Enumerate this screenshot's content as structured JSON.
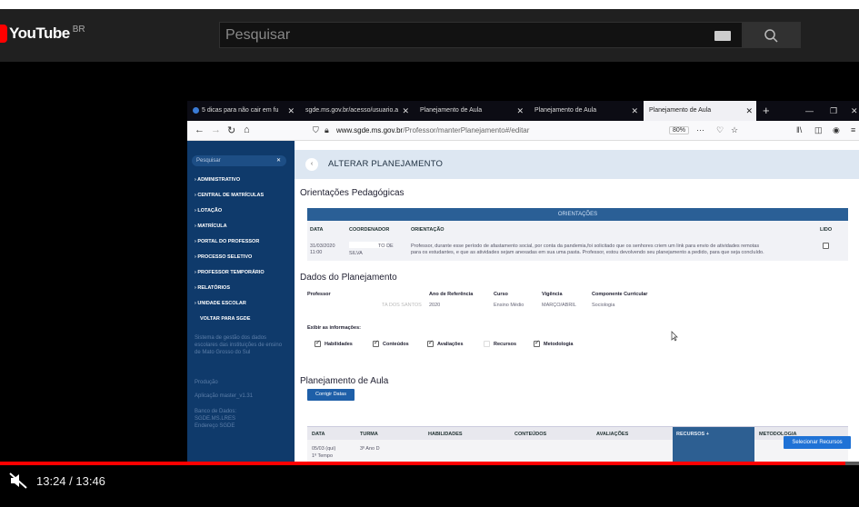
{
  "youtube": {
    "logo_text": "YouTube",
    "country_code": "BR",
    "search_placeholder": "Pesquisar"
  },
  "browser": {
    "tabs": [
      {
        "label": "5 dicas para não cair em fu"
      },
      {
        "label": "sgde.ms.gov.br/acesso/usuario.a"
      },
      {
        "label": "Planejamento de Aula"
      },
      {
        "label": "Planejamento de Aula"
      },
      {
        "label": "Planejamento de Aula"
      }
    ],
    "url_host": "www.sgde.ms.gov.br",
    "url_path": "/Professor/manterPlanejamento#/editar",
    "zoom": "80%"
  },
  "sidebar": {
    "search_placeholder": "Pesquisar",
    "items": [
      {
        "label": "› ADMINISTRATIVO"
      },
      {
        "label": "› CENTRAL DE MATRÍCULAS"
      },
      {
        "label": "› LOTAÇÃO"
      },
      {
        "label": "› MATRÍCULA"
      },
      {
        "label": "› PORTAL DO PROFESSOR"
      },
      {
        "label": "› PROCESSO SELETIVO"
      },
      {
        "label": "› PROFESSOR TEMPORÁRIO"
      },
      {
        "label": "› RELATÓRIOS"
      },
      {
        "label": "› UNIDADE ESCOLAR"
      },
      {
        "label": "VOLTAR PARA SGDE"
      }
    ],
    "info_text": "Sistema de gestão dos dados escolares das instituições de ensino de Mato Grosso do Sul",
    "env_label": "Produção",
    "app_version": "Aplicação master_v1.31",
    "db_label": "Banco de Dados:",
    "db_value": "SGDE.MS.LRES",
    "server_value": "Endereço SGDE"
  },
  "main": {
    "title": "ALTERAR PLANEJAMENTO",
    "orient_section": "Orientações Pedagógicas",
    "orient_table_title": "ORIENTAÇÕES",
    "orient_cols": {
      "data": "DATA",
      "coord": "COORDENADOR",
      "orient": "ORIENTAÇÃO",
      "lido": "LIDO"
    },
    "orient_row": {
      "date": "31/03/2020",
      "time": "11:00",
      "coord_1": "TO DE",
      "coord_2": "SILVA",
      "text_1": "Professor, durante esse período de afastamento social, por conta da pandemia,foi solicitado que os senhores criem um link para envio de atividades remotas",
      "text_2": "para os estudantes, e que as atividades sejam anexadas em sua uma pasta. Professor, estou devolvendo seu planejamento a pedido, para que seja concluído."
    },
    "dados_section": "Dados do Planejamento",
    "dados_labels": {
      "professor": "Professor",
      "ano": "Ano de Referência",
      "curso": "Curso",
      "vigencia": "Vigência",
      "componente": "Componente Curricular"
    },
    "dados_values": {
      "professor": "TA DOS SANTOS",
      "ano": "2020",
      "curso": "Ensino Médio",
      "vigencia": "MARÇO/ABRIL",
      "componente": "Sociologia"
    },
    "exibir_label": "Exibir as informações:",
    "exibir_options": [
      {
        "label": "Habilidades",
        "checked": true
      },
      {
        "label": "Conteúdos",
        "checked": true
      },
      {
        "label": "Avaliações",
        "checked": true
      },
      {
        "label": "Recursos",
        "checked": false
      },
      {
        "label": "Metodologia",
        "checked": true
      }
    ],
    "plan_section": "Planejamento de Aula",
    "corrigir_btn": "Corrigir Datas",
    "plan_cols": {
      "data": "DATA",
      "turma": "TURMA",
      "hab": "HABILIDADES",
      "cont": "CONTEÚDOS",
      "aval": "AVALIAÇÕES",
      "rec": "RECURSOS +",
      "met": "METODOLOGIA"
    },
    "plan_row": {
      "date": "05/03 (qui)",
      "sub": "1º Tempo",
      "turma": "3º Ano D"
    },
    "select_btn": "Selecionar Recursos"
  },
  "player": {
    "time": "13:24 / 13:46",
    "progress": 0.984
  }
}
